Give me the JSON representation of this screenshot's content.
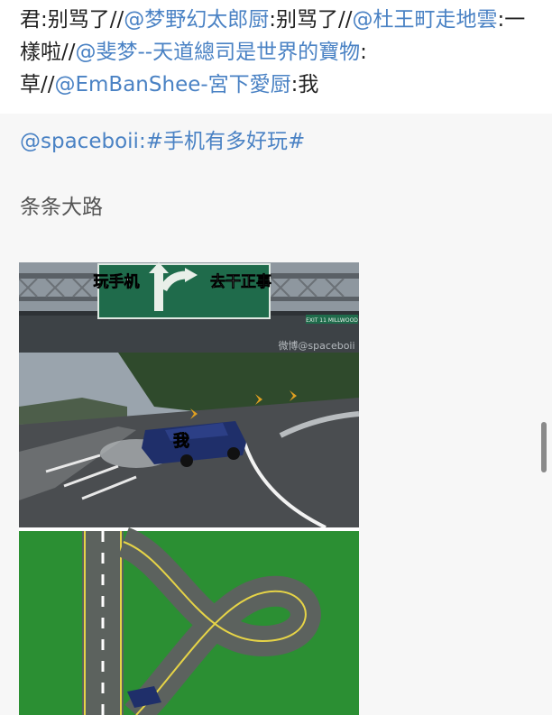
{
  "repost_chain": [
    {
      "text": "君:别骂了//",
      "mention": false
    },
    {
      "text": "@梦野幻太郎厨",
      "mention": true
    },
    {
      "text": ":别骂了//",
      "mention": false
    },
    {
      "text": "@杜王町走地雲",
      "mention": true
    },
    {
      "text": ":一樣啦//",
      "mention": false
    },
    {
      "text": "@斐梦--天道總司是世界的寶物",
      "mention": true
    },
    {
      "text": ":草//",
      "mention": false
    },
    {
      "text": "@EmBanShee-宮下愛厨",
      "mention": true
    },
    {
      "text": ":我",
      "mention": false
    }
  ],
  "post": {
    "author": "@spaceboii",
    "sep": ":",
    "hashtag": "#手机有多好玩#",
    "body": "条条大路"
  },
  "meme": {
    "sign_left": "玩手机",
    "sign_right": "去干正事",
    "exit_plate": "EXIT 11  MILLWOOD",
    "car_label": "我",
    "watermark": "微博@spaceboii"
  },
  "colors": {
    "mention": "#4a82c4",
    "sign_green": "#1f6b4b",
    "grass": "#2b8f33"
  }
}
